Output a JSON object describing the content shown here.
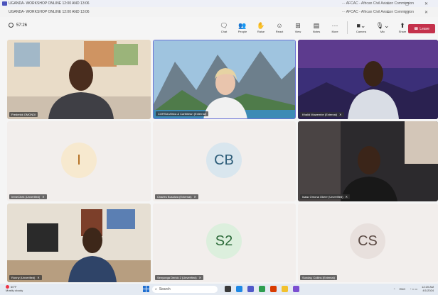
{
  "titlebars": {
    "window1_title": "UGANDA- WORKSHOP ONLINE 12:00 AND 13:06",
    "window1_right": "···  AFCAC - African Civil Aviation Commission",
    "window2_title": "UGANDA- WORKSHOP ONLINE 12:00 AND 13:06",
    "window2_right": "···  AFCAC - African Civil Aviation Commission"
  },
  "toolbar": {
    "timer": "57:26",
    "buttons": [
      {
        "label": "Chat",
        "icon": "chat-icon"
      },
      {
        "label": "People",
        "icon": "people-icon"
      },
      {
        "label": "Raise",
        "icon": "raise-hand-icon"
      },
      {
        "label": "React",
        "icon": "react-icon"
      },
      {
        "label": "View",
        "icon": "view-icon"
      },
      {
        "label": "Notes",
        "icon": "notes-icon"
      },
      {
        "label": "More",
        "icon": "more-icon"
      }
    ],
    "media": [
      {
        "label": "Camera",
        "icon": "camera-icon"
      },
      {
        "label": "Mic",
        "icon": "mic-icon"
      },
      {
        "label": "Share",
        "icon": "share-icon"
      }
    ],
    "leave_label": "Leave"
  },
  "participants": [
    {
      "name": "Frederick OMONDI",
      "type": "video",
      "scene": "office-wall"
    },
    {
      "name": "CORSIA Africa & Caribbean (External)",
      "type": "video",
      "scene": "mountain-backdrop",
      "selected": true
    },
    {
      "name": "Khalid Muwembe (External)",
      "type": "video",
      "scene": "night-landscape"
    },
    {
      "name": "IreneChek (Unverified)",
      "type": "avatar",
      "initials": "I",
      "avatar_color": "#f7e9cf",
      "text_color": "#b16a1a"
    },
    {
      "name": "Charles Busolwa (External)",
      "type": "avatar",
      "initials": "CB",
      "avatar_color": "#d9e6ee",
      "text_color": "#2c5c78"
    },
    {
      "name": "Isaac Omona Okeer (Unverified)",
      "type": "video",
      "scene": "room"
    },
    {
      "name": "Ronny (Unverified)",
      "type": "video",
      "scene": "office-desk"
    },
    {
      "name": "Senyonga Derick 2 (Unverified)",
      "type": "avatar",
      "initials": "S2",
      "avatar_color": "#dcefdd",
      "text_color": "#2d6b3a"
    },
    {
      "name": "Sunday, Collins (External)",
      "type": "avatar",
      "initials": "CS",
      "avatar_color": "#e8e0dd",
      "text_color": "#5b4a44"
    }
  ],
  "taskbar": {
    "weather_temp": "60°F",
    "weather_desc": "Mostly cloudy",
    "search_placeholder": "Search",
    "lang": "ENG",
    "time": "12:20 AM",
    "date": "4/1/2024"
  }
}
